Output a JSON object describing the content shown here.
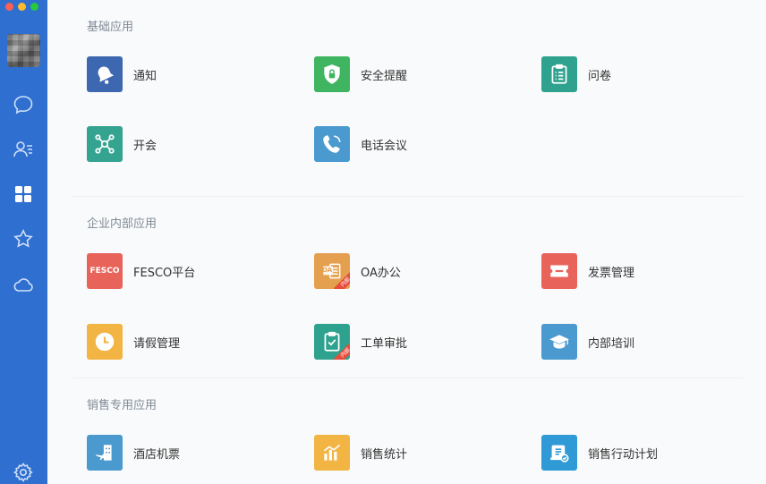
{
  "window": {
    "controls": {
      "close_color": "#fe5f57",
      "minimize_color": "#febc2e",
      "maximize_color": "#28c840"
    }
  },
  "sidebar": {
    "background": "#2f6fcf",
    "items": [
      {
        "name": "chat-icon"
      },
      {
        "name": "contacts-icon"
      },
      {
        "name": "apps-grid-icon",
        "active": true
      },
      {
        "name": "star-icon"
      },
      {
        "name": "cloud-icon"
      },
      {
        "name": "settings-gear-icon"
      }
    ]
  },
  "sections": [
    {
      "title": "基础应用",
      "apps": [
        {
          "label": "通知",
          "icon": "bell-icon",
          "color": "#3d67b0"
        },
        {
          "label": "安全提醒",
          "icon": "shield-lock-icon",
          "color": "#3fb562"
        },
        {
          "label": "问卷",
          "icon": "clipboard-list-icon",
          "color": "#2fa28f"
        },
        {
          "label": "开会",
          "icon": "meeting-nodes-icon",
          "color": "#34a390"
        },
        {
          "label": "电话会议",
          "icon": "phone-conference-icon",
          "color": "#4a9ad0"
        }
      ]
    },
    {
      "title": "企业内部应用",
      "apps": [
        {
          "label": "FESCO平台",
          "icon": "fesco-logo-icon",
          "icon_text": "FESCO",
          "color": "#e8645a"
        },
        {
          "label": "OA办公",
          "icon": "oa-document-icon",
          "icon_text": "OA",
          "badge": "内部",
          "color": "#e5a04f"
        },
        {
          "label": "发票管理",
          "icon": "ticket-icon",
          "color": "#e8645a"
        },
        {
          "label": "请假管理",
          "icon": "clock-icon",
          "color": "#f2b443"
        },
        {
          "label": "工单审批",
          "icon": "clipboard-check-icon",
          "badge": "内部",
          "color": "#2fa28f"
        },
        {
          "label": "内部培训",
          "icon": "graduation-cap-icon",
          "color": "#4a9ad0"
        }
      ]
    },
    {
      "title": "销售专用应用",
      "apps": [
        {
          "label": "酒店机票",
          "icon": "hotel-plane-icon",
          "color": "#4a9ad0"
        },
        {
          "label": "销售统计",
          "icon": "bar-chart-icon",
          "color": "#f2b443"
        },
        {
          "label": "销售行动计划",
          "icon": "plan-check-icon",
          "color": "#2f9ad6"
        }
      ]
    }
  ]
}
